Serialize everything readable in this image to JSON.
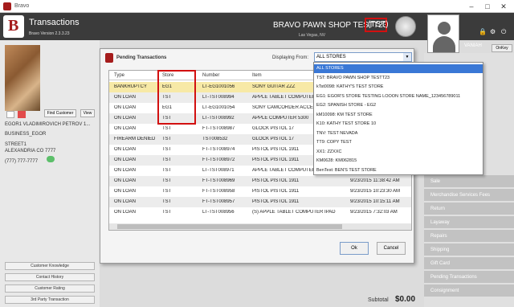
{
  "window": {
    "title": "Bravo"
  },
  "header": {
    "page_title": "Transactions",
    "version": "Bravo Version 2.3.3.23",
    "shop_name": "BRAVO PAWN SHOP TESTT23",
    "shop_code": "(TST)",
    "location": "Las Vegas, NV",
    "user_name": "VANIAH",
    "onkey_label": "OnKey"
  },
  "customer": {
    "find_label": "Find Customer",
    "view_label": "View",
    "name": "EGOR1 VLADIMIROVICH PETROV 1...",
    "business": "BUSINESS_EGOR",
    "street": "STREET1",
    "city": "ALEXANDRIA CO 7777",
    "phone": "(777) 777-7777"
  },
  "left_buttons": [
    "Customer Knowledge",
    "Contact History",
    "Customer Rating",
    "3rd Party Transaction"
  ],
  "right_menu": [
    "Sale",
    "Merchandise Services Fees",
    "Return",
    "Layaway",
    "Repairs",
    "Shipping",
    "Gift Card",
    "Pending Transactions",
    "Consignment"
  ],
  "subtotal": {
    "label": "Subtotal",
    "value": "$0.00"
  },
  "dialog": {
    "title": "Pending Transactions",
    "displaying_label": "Displaying From:",
    "selected_store": "ALL STORES",
    "columns": [
      "Type",
      "Store",
      "Number",
      "Item"
    ],
    "rows": [
      {
        "type": "BANKRUPTCY",
        "store": "EG1",
        "number": "LT-EG1001056",
        "item": "SONY GUITAR ZZZ",
        "date": ""
      },
      {
        "type": "ON LOAN",
        "store": "TST",
        "number": "LT-TST008994",
        "item": "APPLE TABLET COMPUTER",
        "date": ""
      },
      {
        "type": "ON LOAN",
        "store": "EG1",
        "number": "LT-EG1001054",
        "item": "SONY CAMCORDER ACCE",
        "date": ""
      },
      {
        "type": "ON LOAN",
        "store": "TST",
        "number": "LT-TST008992",
        "item": "APPLE COMPUTER 5300",
        "date": ""
      },
      {
        "type": "ON LOAN",
        "store": "TST",
        "number": "FT-TST008987",
        "item": "GLOCK PISTOL 17",
        "date": ""
      },
      {
        "type": "FIREARM DENIED",
        "store": "TST",
        "number": "TST008532",
        "item": "GLOCK PISTOL 17",
        "date": ""
      },
      {
        "type": "ON LOAN",
        "store": "TST",
        "number": "FT-TST008974",
        "item": "PISTOL PISTOL 1911",
        "date": ""
      },
      {
        "type": "ON LOAN",
        "store": "TST",
        "number": "FT-TST008972",
        "item": "PISTOL PISTOL 1911",
        "date": ""
      },
      {
        "type": "ON LOAN",
        "store": "TST",
        "number": "LT-TST008971",
        "item": "APPLE TABLET COMPUTER IPAD",
        "date": "9/23/2015 11:25:37 AM"
      },
      {
        "type": "ON LOAN",
        "store": "TST",
        "number": "FT-TST008969",
        "item": "PISTOL PISTOL 1911",
        "date": "9/23/2015 11:38:42 AM"
      },
      {
        "type": "ON LOAN",
        "store": "TST",
        "number": "FT-TST008958",
        "item": "PISTOL PISTOL 1911",
        "date": "9/23/2015 10:23:30 AM"
      },
      {
        "type": "ON LOAN",
        "store": "TST",
        "number": "FT-TST008957",
        "item": "PISTOL PISTOL 1911",
        "date": "9/23/2015 10:15:11 AM"
      },
      {
        "type": "ON LOAN",
        "store": "TST",
        "number": "LT-TST008956",
        "item": "(S) APPLE TABLET COMPUTER IPAD",
        "date": "9/23/2015 7:32:03 AM"
      }
    ],
    "ok_label": "Ok",
    "cancel_label": "Cancel"
  },
  "store_options": [
    "ALL STORES",
    "TST: BRAVO PAWN SHOP TESTT23",
    "kTst0098: KATHY'S TEST STORE",
    "EG1: EGOR'S STORE TESTING LOOON STORE NAME_123456789011",
    "EG2: SPANISH STORE - EG2",
    "kM10098: KM TEST STORE",
    "K10: KATHY TEST STORE 10",
    "TNV: TEST NEVADA",
    "TT9: COPY TEST",
    "XX1: ZZXXC",
    "KM0628: KM062815",
    "BenTest: BEN'S TEST STORE"
  ]
}
